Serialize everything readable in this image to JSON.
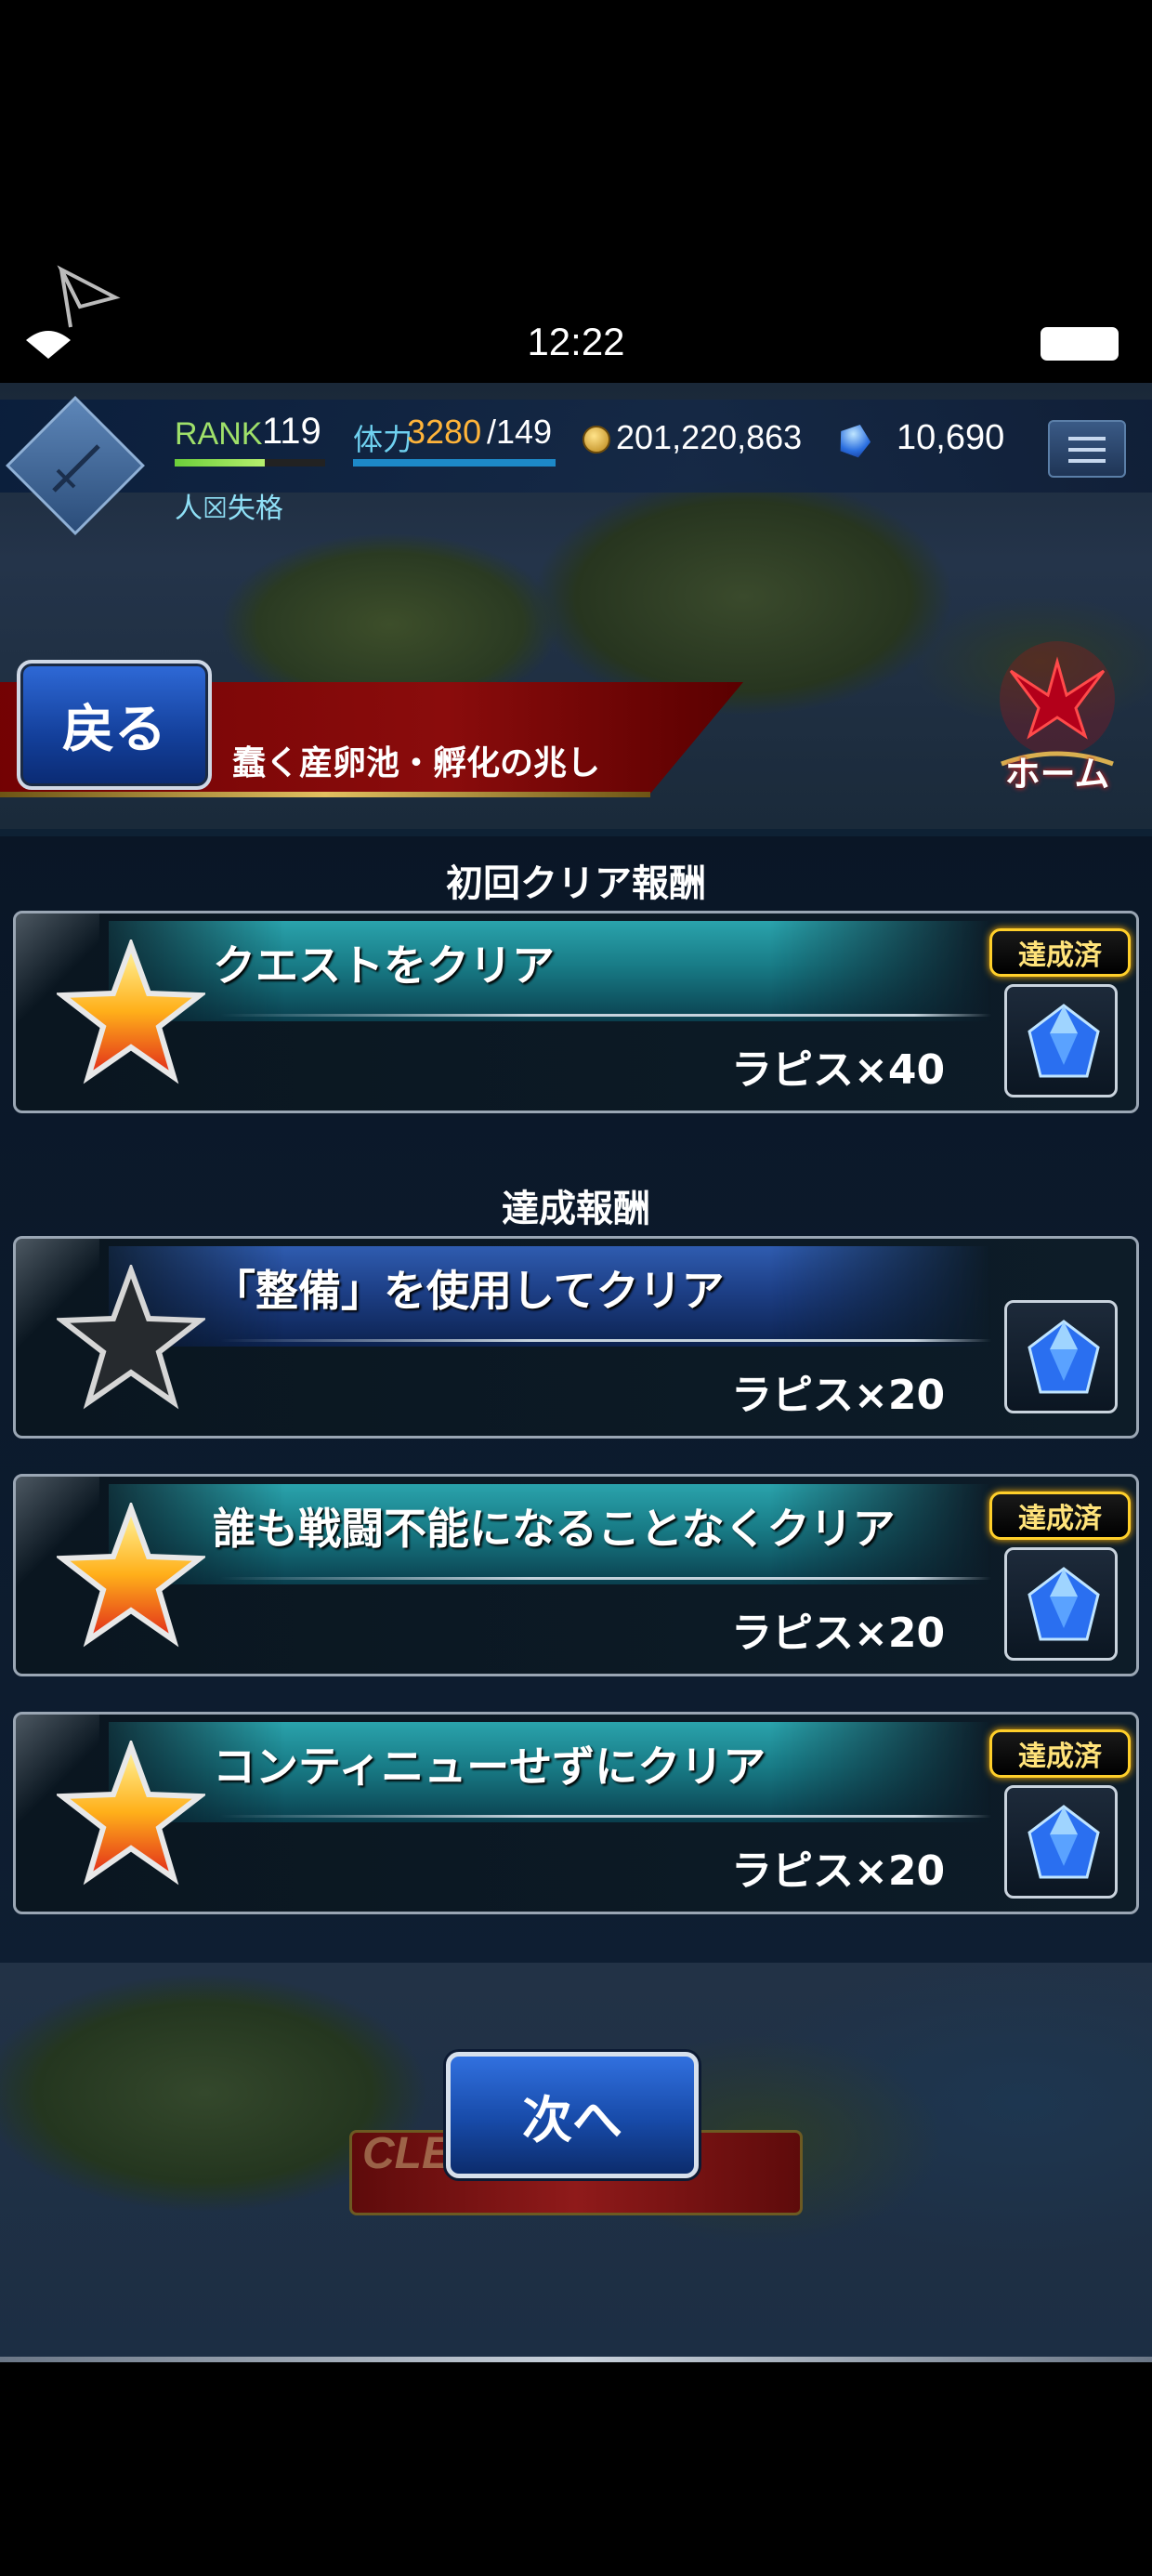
{
  "status": {
    "time": "12:22"
  },
  "header": {
    "rank_label": "RANK",
    "rank_value": "119",
    "stamina_label": "体力",
    "stamina_value": "3280",
    "stamina_max": "/149",
    "gil": "201,220,863",
    "lapis": "10,690",
    "username": "人☒失格"
  },
  "nav": {
    "back_label": "戻る",
    "quest_name": "蠢く産卵池・孵化の兆し",
    "home_label": "ホーム"
  },
  "rewards": {
    "first_clear_title": "初回クリア報酬",
    "achievement_title": "達成報酬",
    "completed_badge": "達成済",
    "items": [
      {
        "title": "クエストをクリア",
        "reward": "ラピス×40",
        "completed": true
      },
      {
        "title": "「整備」を使用してクリア",
        "reward": "ラピス×20",
        "completed": false
      },
      {
        "title": "誰も戦闘不能になることなくクリア",
        "reward": "ラピス×20",
        "completed": true
      },
      {
        "title": "コンティニューせずにクリア",
        "reward": "ラピス×20",
        "completed": true
      }
    ]
  },
  "footer": {
    "next_label": "次へ",
    "underlay_text": "CLE"
  },
  "colors": {
    "accent_blue": "#174aa8",
    "badge_gold": "#ffcf2a",
    "band_teal": "#187b86",
    "band_blue": "#1d3f86"
  },
  "icons": [
    "signal-icon",
    "battery-icon",
    "gil-coin-icon",
    "lapis-gem-icon",
    "menu-icon",
    "home-crest-icon",
    "star-gold-icon",
    "star-gray-icon",
    "lapis-crystal-icon"
  ]
}
